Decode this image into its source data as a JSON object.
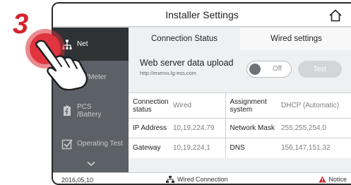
{
  "step": "3",
  "header": {
    "title": "Installer Settings",
    "home_icon": "home-icon"
  },
  "sidebar": {
    "items": [
      {
        "label": "Net",
        "icon": "network-icon",
        "active": true
      },
      {
        "label": "PV/Meter",
        "icon": "solar-panel-icon",
        "active": false
      },
      {
        "label": "PCS\n/Battery",
        "icon": "battery-icon",
        "active": false
      },
      {
        "label": "Operating Test",
        "icon": "checkbox-icon",
        "active": false
      }
    ],
    "more_icon": "chevron-down-icon"
  },
  "tabs": {
    "connection_status": "Connection Status",
    "wired_settings": "Wired settings"
  },
  "web_upload": {
    "title": "Web server data upload",
    "url": "http://enervu.lg-ess.com",
    "toggle_label": "Off",
    "test_label": "Test"
  },
  "info_table": [
    {
      "label1": "Connection status",
      "value1": "Wired",
      "label2": "Assignment system",
      "value2": "DHCP (Automatic)"
    },
    {
      "label1": "IP Address",
      "value1": "10,19,224,79",
      "label2": "Network Mask",
      "value2": "255,255,254,0"
    },
    {
      "label1": "Gateway",
      "value1": "10,19,224,1",
      "label2": "DNS",
      "value2": "156,147,151,32"
    }
  ],
  "status_bar": {
    "date": "2016,05,10",
    "connection": "Wired Connection",
    "notice": "Notice"
  },
  "colors": {
    "accent_red": "#d4232d",
    "sidebar_bg": "#5c6167",
    "sidebar_active": "#2f3336"
  }
}
